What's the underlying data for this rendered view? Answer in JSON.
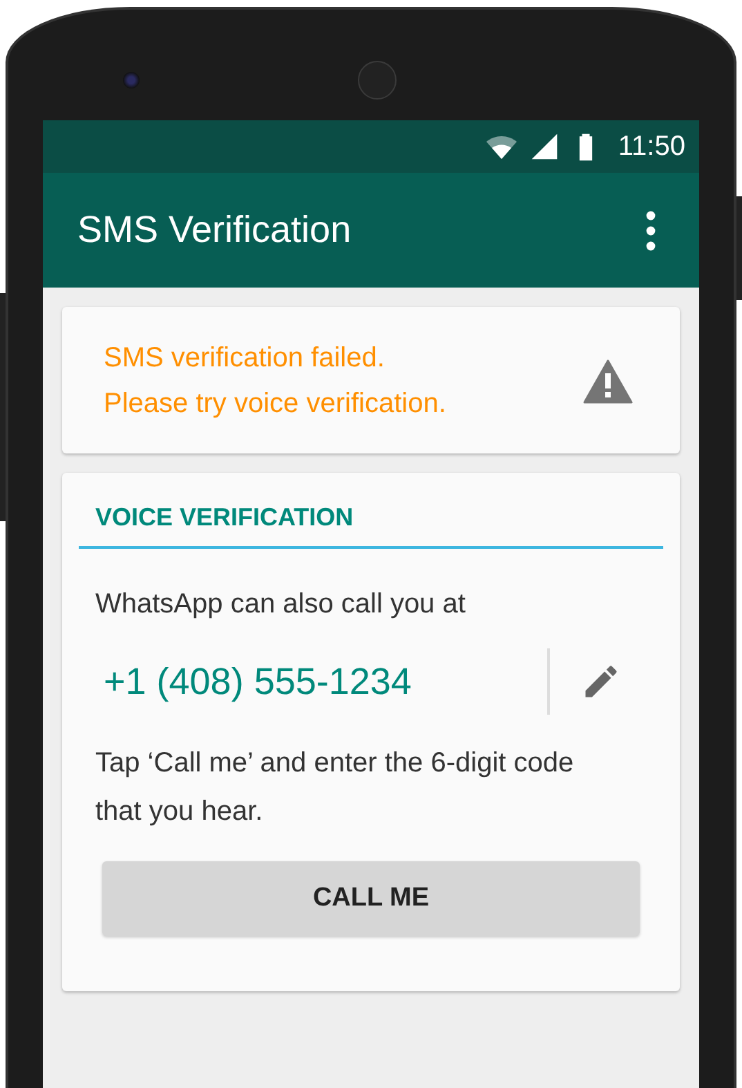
{
  "status_bar": {
    "time": "11:50"
  },
  "app_bar": {
    "title": "SMS Verification"
  },
  "alert": {
    "lines": [
      "SMS verification failed.",
      "Please try voice verification."
    ]
  },
  "voice_card": {
    "heading": "VOICE VERIFICATION",
    "intro": "WhatsApp can also call you at",
    "phone_number": "+1 (408) 555-1234",
    "instructions": "Tap ‘Call me’ and enter the 6-digit code that you hear.",
    "button": "CALL ME"
  }
}
